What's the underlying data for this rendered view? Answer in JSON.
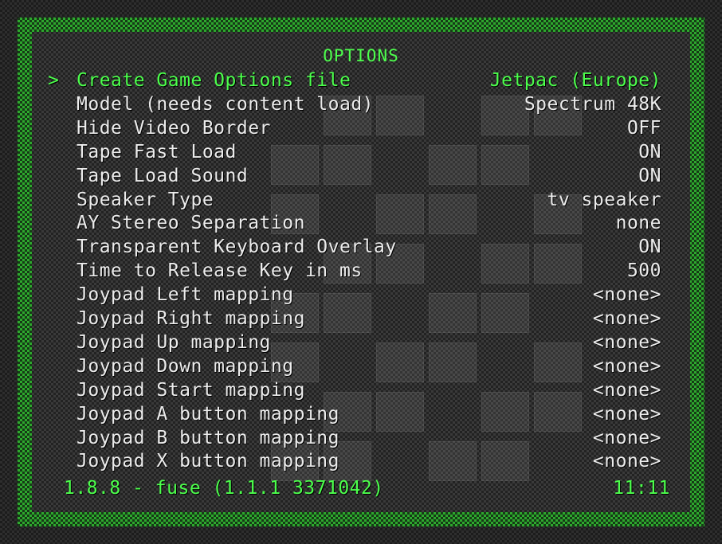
{
  "title": "OPTIONS",
  "cursor": ">",
  "options": [
    {
      "label": "Create Game Options file",
      "value": "Jetpac (Europe)",
      "selected": true
    },
    {
      "label": "Model (needs content load)",
      "value": "Spectrum 48K"
    },
    {
      "label": "Hide Video Border",
      "value": "OFF"
    },
    {
      "label": "Tape Fast Load",
      "value": "ON"
    },
    {
      "label": "Tape Load Sound",
      "value": "ON"
    },
    {
      "label": "Speaker Type",
      "value": "tv speaker"
    },
    {
      "label": "AY Stereo Separation",
      "value": "none"
    },
    {
      "label": "Transparent Keyboard Overlay",
      "value": "ON"
    },
    {
      "label": "Time to Release Key in ms",
      "value": "500"
    },
    {
      "label": "Joypad Left mapping",
      "value": "<none>"
    },
    {
      "label": "Joypad Right mapping",
      "value": "<none>"
    },
    {
      "label": "Joypad Up mapping",
      "value": "<none>"
    },
    {
      "label": "Joypad Down mapping",
      "value": "<none>"
    },
    {
      "label": "Joypad Start mapping",
      "value": "<none>"
    },
    {
      "label": "Joypad A button mapping",
      "value": "<none>"
    },
    {
      "label": "Joypad B button mapping",
      "value": "<none>"
    },
    {
      "label": "Joypad X button mapping",
      "value": "<none>"
    }
  ],
  "footer": {
    "version": "1.8.8 - fuse (1.1.1 3371042)",
    "clock": "11:11"
  },
  "colors": {
    "highlight": "#4cff4c",
    "text": "#ececec",
    "border": "#2ea82e"
  }
}
